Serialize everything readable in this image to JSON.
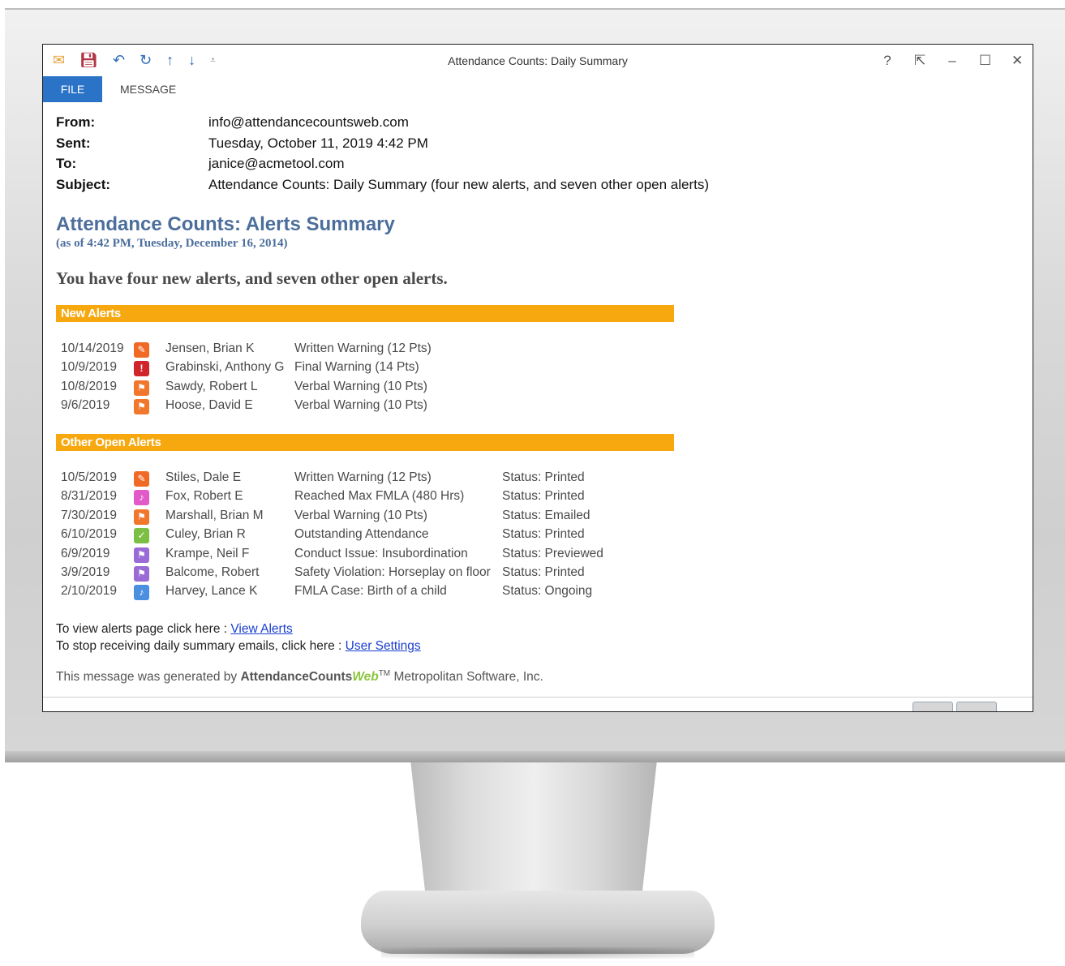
{
  "window": {
    "title": "Attendance Counts: Daily Summary",
    "qat_icons": [
      "mail-icon",
      "save-icon",
      "undo-icon",
      "redo-icon",
      "arrow-up-icon",
      "arrow-down-icon",
      "customize-icon"
    ],
    "controls": {
      "help": "?",
      "restore_ribbon": "⇱",
      "minimize": "–",
      "maximize": "☐",
      "close": "✕"
    }
  },
  "tabs": {
    "file": "FILE",
    "message": "MESSAGE"
  },
  "headers": {
    "from_label": "From:",
    "from_value": "info@attendancecountsweb.com",
    "sent_label": "Sent:",
    "sent_value": "Tuesday, October 11, 2019 4:42 PM",
    "to_label": "To:",
    "to_value": "janice@acmetool.com",
    "subject_label": "Subject:",
    "subject_value": "Attendance Counts: Daily Summary (four new alerts, and seven other open alerts)"
  },
  "summary": {
    "title": "Attendance Counts: Alerts Summary",
    "subtitle": "(as of 4:42 PM, Tuesday, December 16, 2014)",
    "message": "You have four new alerts, and seven other open alerts."
  },
  "new_alerts": {
    "heading": "New Alerts",
    "rows": [
      {
        "date": "10/14/2019",
        "icon": "pencil-icon",
        "icon_glyph": "✎",
        "icon_color": "#f06a25",
        "name": "Jensen, Brian K",
        "type": "Written Warning (12 Pts)"
      },
      {
        "date": "10/9/2019",
        "icon": "exclamation-icon",
        "icon_glyph": "!",
        "icon_color": "#d0252b",
        "name": "Grabinski, Anthony G",
        "type": "Final Warning (14 Pts)"
      },
      {
        "date": "10/8/2019",
        "icon": "flag-icon",
        "icon_glyph": "⚑",
        "icon_color": "#f0772b",
        "name": "Sawdy, Robert L",
        "type": "Verbal Warning (10 Pts)"
      },
      {
        "date": "9/6/2019",
        "icon": "flag-icon",
        "icon_glyph": "⚑",
        "icon_color": "#f0772b",
        "name": "Hoose, David E",
        "type": "Verbal Warning (10 Pts)"
      }
    ]
  },
  "open_alerts": {
    "heading": "Other Open Alerts",
    "rows": [
      {
        "date": "10/5/2019",
        "icon": "pencil-icon",
        "icon_glyph": "✎",
        "icon_color": "#f06a25",
        "name": "Stiles, Dale E",
        "type": "Written Warning (12 Pts)",
        "status": "Status: Printed"
      },
      {
        "date": "8/31/2019",
        "icon": "bell-icon",
        "icon_glyph": "♪",
        "icon_color": "#e25ac8",
        "name": "Fox, Robert E",
        "type": "Reached Max FMLA (480 Hrs)",
        "status": "Status: Printed"
      },
      {
        "date": "7/30/2019",
        "icon": "flag-icon",
        "icon_glyph": "⚑",
        "icon_color": "#f0772b",
        "name": "Marshall, Brian M",
        "type": "Verbal Warning (10 Pts)",
        "status": "Status: Emailed"
      },
      {
        "date": "6/10/2019",
        "icon": "thumbs-up-icon",
        "icon_glyph": "✓",
        "icon_color": "#7cbf43",
        "name": "Culey, Brian R",
        "type": "Outstanding Attendance",
        "status": "Status: Printed"
      },
      {
        "date": "6/9/2019",
        "icon": "flag-icon",
        "icon_glyph": "⚑",
        "icon_color": "#9a6ad6",
        "name": "Krampe, Neil F",
        "type": "Conduct Issue: Insubordination",
        "status": "Status: Previewed"
      },
      {
        "date": "3/9/2019",
        "icon": "flag-icon",
        "icon_glyph": "⚑",
        "icon_color": "#9a6ad6",
        "name": "Balcome, Robert",
        "type": "Safety Violation: Horseplay on floor",
        "status": "Status: Printed"
      },
      {
        "date": "2/10/2019",
        "icon": "bell-icon",
        "icon_glyph": "♪",
        "icon_color": "#4a8fe0",
        "name": "Harvey, Lance K",
        "type": "FMLA Case: Birth of a child",
        "status": "Status: Ongoing"
      }
    ]
  },
  "links": {
    "view_prefix": "To view alerts page click here : ",
    "view_link": "View Alerts",
    "settings_prefix": "To stop receiving daily summary emails, click here : ",
    "settings_link": "User Settings"
  },
  "footer": {
    "prefix": "This message was generated by ",
    "brand": "AttendanceCounts",
    "brand_web": "Web",
    "tm": "TM",
    "suffix": " Metropolitan Software, Inc."
  }
}
